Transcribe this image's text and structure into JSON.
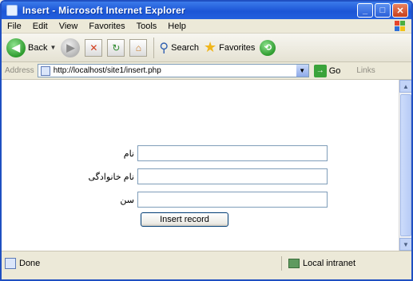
{
  "window": {
    "title": "Insert - Microsoft Internet Explorer"
  },
  "menu": [
    "File",
    "Edit",
    "View",
    "Favorites",
    "Tools",
    "Help"
  ],
  "toolbar": {
    "back_label": "Back",
    "search_label": "Search",
    "favorites_label": "Favorites"
  },
  "address": {
    "label": "Address",
    "url": "http://localhost/site1/insert.php",
    "go_label": "Go",
    "links_label": "Links"
  },
  "form": {
    "fields": [
      {
        "label": "نام",
        "value": ""
      },
      {
        "label": "نام خانوادگی",
        "value": ""
      },
      {
        "label": "سن",
        "value": ""
      }
    ],
    "submit_label": "Insert record"
  },
  "status": {
    "left": "Done",
    "zone": "Local intranet"
  }
}
